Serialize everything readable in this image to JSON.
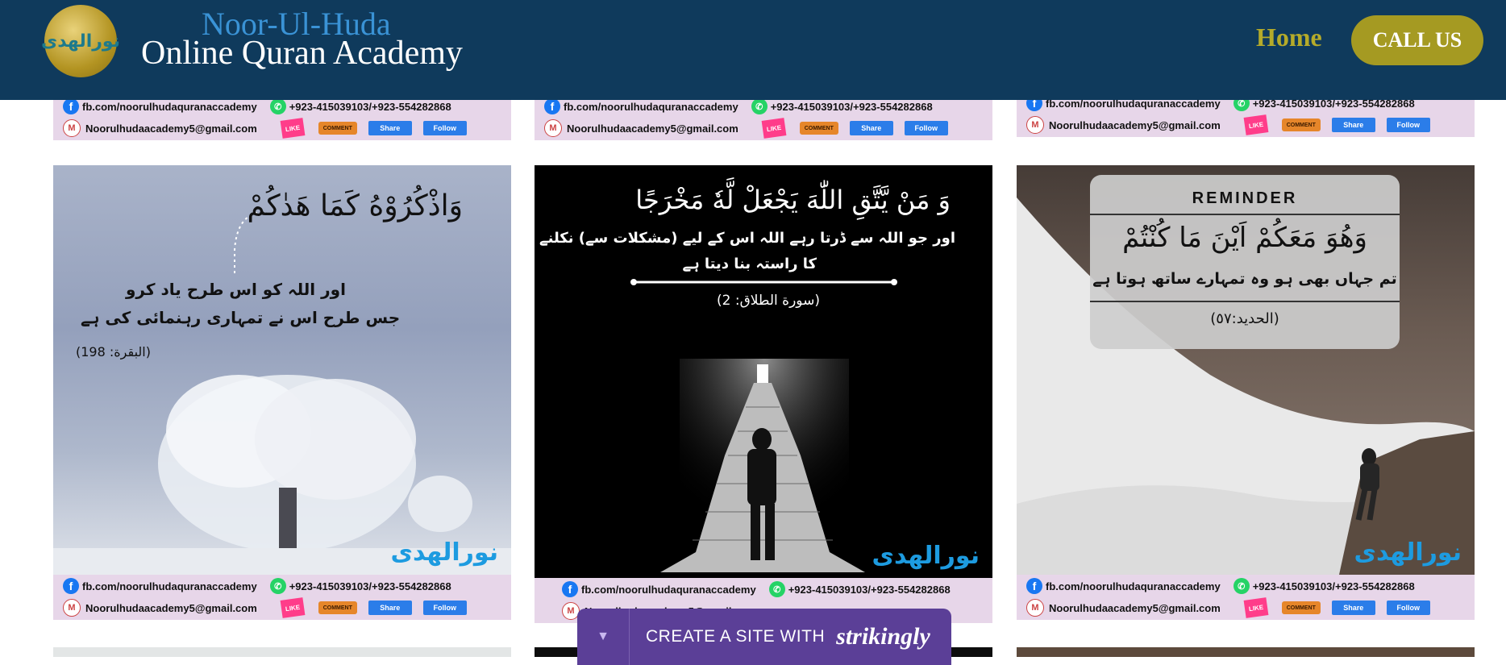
{
  "header": {
    "brand_line1": "Noor-Ul-Huda",
    "brand_line2": "Online Quran Academy",
    "logo_text": "نورالهدى",
    "nav_home": "Home",
    "call_button": "CALL US"
  },
  "footer_strip": {
    "facebook": "fb.com/noorulhudaquranaccademy",
    "whatsapp": "+923-415039103/+923-554282868",
    "email": "Noorulhudaacademy5@gmail.com",
    "like": "LIKE",
    "comment": "COMMENT",
    "share": "Share",
    "follow": "Follow"
  },
  "cards": [
    {
      "ayah": "وَاذْكُرُوْهُ كَمَا هَدٰكُمْ",
      "translation_line1": "اور اللہ کو اس طرح یاد کرو",
      "translation_line2": "جس طرح اس نے تمہاری رہنمائی کی ہے",
      "reference": "(البقرة: 198)",
      "logo": "نورالهدى"
    },
    {
      "ayah": "وَ مَنْ يَّتَّقِ اللّٰهَ يَجْعَلْ لَّهٗ مَخْرَجًا",
      "translation_line1": "اور جو اللہ سے ڈرتا رہے اللہ اس کے لیے (مشکلات سے) نکلنے",
      "translation_line2": "کا راستہ بنا دیتا ہے",
      "reference": "(سورة الطلاق: 2)",
      "logo": "نورالهدى"
    },
    {
      "title": "REMINDER",
      "ayah": "وَهُوَ مَعَكُمْ اَيْنَ مَا كُنْتُمْ",
      "translation_line1": "تم جہاں بھی ہو وہ تمہارے ساتھ ہوتا ہے",
      "reference": "(الحديد:٥٧)",
      "logo": "نورالهدى"
    }
  ],
  "promo": {
    "text": "CREATE A SITE WITH",
    "brand": "strikingly"
  }
}
